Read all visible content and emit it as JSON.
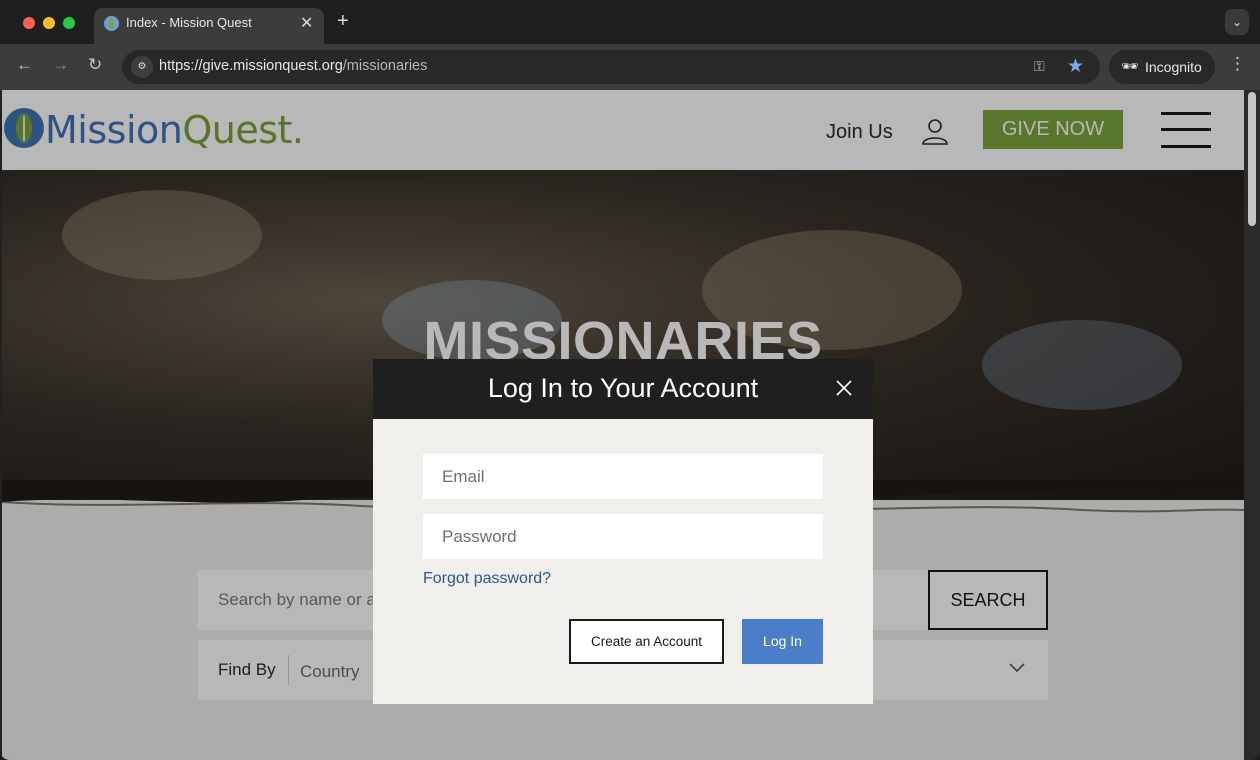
{
  "browser": {
    "tab_title": "Index - Mission Quest",
    "new_tab_glyph": "+",
    "url_host": "https://give.missionquest.org",
    "url_path": "/missionaries",
    "incognito_label": "Incognito"
  },
  "header": {
    "logo_mission": "Mission",
    "logo_quest": "Quest",
    "logo_period": ".",
    "join_us": "Join Us",
    "give_now": "GIVE NOW"
  },
  "hero": {
    "title": "MISSIONARIES"
  },
  "search": {
    "placeholder": "Search by name or a",
    "button": "SEARCH",
    "find_by_label": "Find By",
    "country_value": "Country"
  },
  "modal": {
    "title": "Log In to Your Account",
    "email_placeholder": "Email",
    "password_placeholder": "Password",
    "forgot_password": "Forgot password?",
    "create_account": "Create an Account",
    "log_in": "Log In"
  },
  "colors": {
    "brand_blue": "#3f74b8",
    "brand_green": "#79a13a",
    "login_button": "#4a7ec9",
    "modal_header": "#1f1f1f"
  },
  "icons": [
    "back-arrow-icon",
    "forward-arrow-icon",
    "reload-icon",
    "site-settings-icon",
    "key-icon",
    "star-icon",
    "incognito-icon",
    "more-vertical-icon",
    "user-icon",
    "hamburger-menu-icon",
    "close-icon",
    "chevron-down-icon"
  ]
}
